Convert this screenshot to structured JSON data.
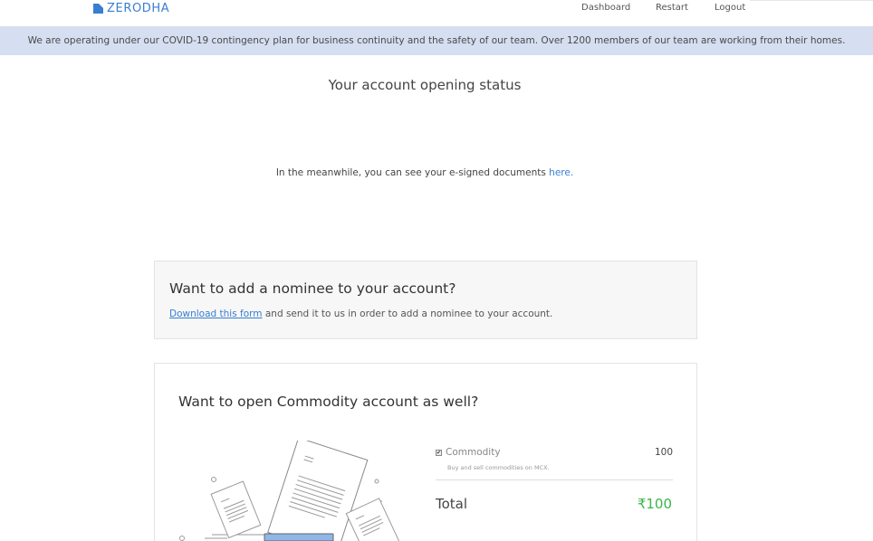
{
  "header": {
    "brand": "ZERODHA",
    "nav": [
      "Dashboard",
      "Restart",
      "Logout"
    ]
  },
  "banner": {
    "text": "We are operating under our COVID-19 contingency plan for business continuity and the safety of our team. Over 1200 members of our team are working from their homes."
  },
  "status": {
    "title": "Your account opening status",
    "meanwhile_text": "In the meanwhile, you can see your e-signed documents ",
    "meanwhile_link": "here."
  },
  "nominee": {
    "title": "Want to add a nominee to your account?",
    "link": "Download this form",
    "text": " and send it to us in order to add a nominee to your account."
  },
  "commodity": {
    "title": "Want to open Commodity account as well?",
    "item_label": "Commodity",
    "item_price": "100",
    "item_desc": "Buy and sell commodities on MCX.",
    "item_checked": true,
    "total_label": "Total",
    "total_value": "₹100"
  },
  "colors": {
    "brand": "#387ed1",
    "banner_bg": "#d5dff1",
    "total_green": "#39b54a"
  }
}
